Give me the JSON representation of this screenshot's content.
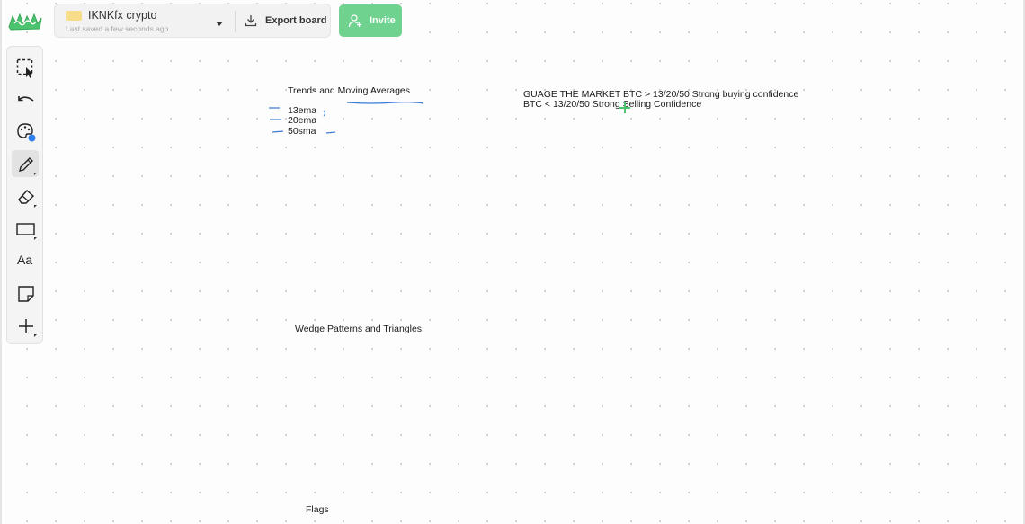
{
  "header": {
    "board_name": "IKNKfx crypto",
    "saved_status": "Last saved a few seconds ago",
    "export_label": "Export board",
    "invite_label": "Invite"
  },
  "toolbar": {
    "tools": [
      {
        "name": "select-tool",
        "icon": "select-cursor-icon"
      },
      {
        "name": "undo-tool",
        "icon": "undo-arrow-icon"
      },
      {
        "name": "color-palette-tool",
        "icon": "palette-icon",
        "indicator_color": "#2f80ed"
      },
      {
        "name": "pen-tool",
        "icon": "pen-icon",
        "active": true
      },
      {
        "name": "eraser-tool",
        "icon": "eraser-icon"
      },
      {
        "name": "rectangle-tool",
        "icon": "rectangle-icon"
      },
      {
        "name": "text-tool",
        "icon": "text-icon",
        "label": "Aa"
      },
      {
        "name": "sticky-note-tool",
        "icon": "sticky-note-icon"
      },
      {
        "name": "add-tool",
        "icon": "plus-icon"
      }
    ]
  },
  "canvas": {
    "trends_title": "Trends and Moving Averages",
    "ma_items": [
      "13ema",
      "20ema",
      "50sma"
    ],
    "market_line1": "GUAGE THE MARKET BTC > 13/20/50 Strong buying confidence",
    "market_line2": "BTC < 13/20/50 Strong Selling Confidence",
    "wedge_title": "Wedge Patterns and Triangles",
    "flags_title": "Flags"
  },
  "colors": {
    "accent_green": "#6fd28f",
    "ink_blue": "#3a7bd5",
    "board_icon": "#f7dc8a",
    "logo_green": "#4cc36e"
  }
}
